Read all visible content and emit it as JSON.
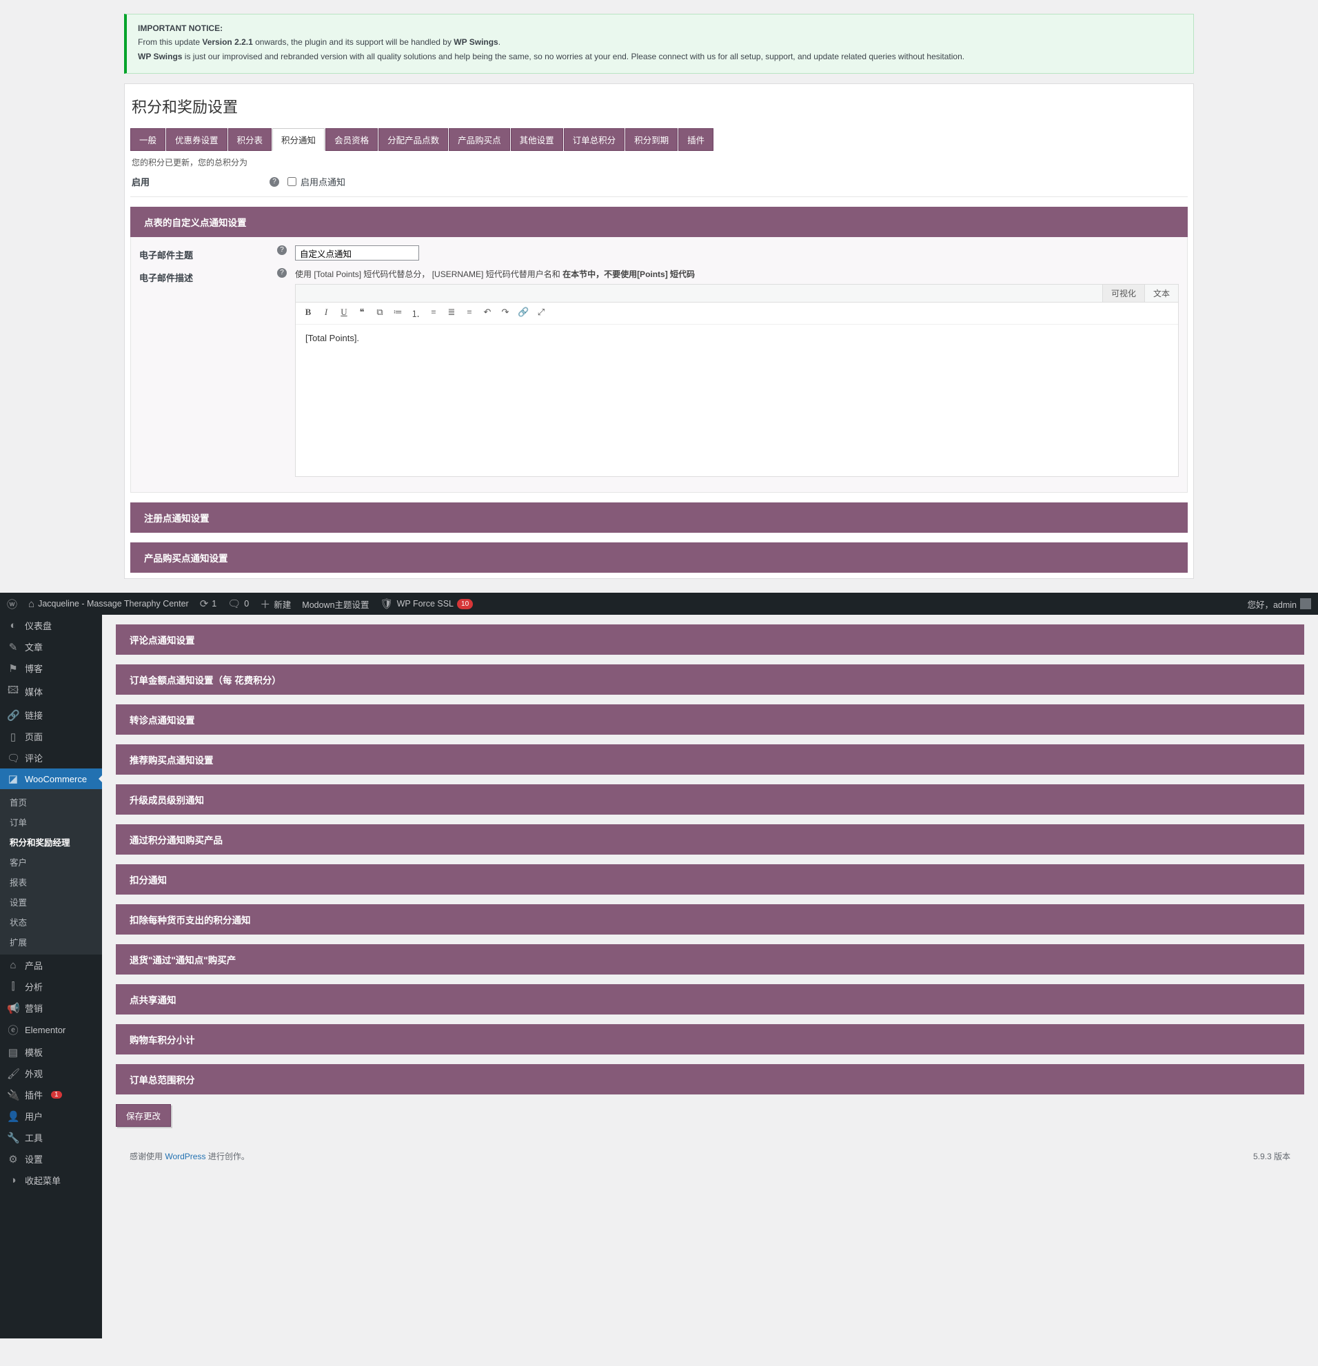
{
  "notice": {
    "heading": "IMPORTANT NOTICE:",
    "line1_a": "From this update ",
    "line1_b": "Version 2.2.1",
    "line1_c": " onwards, the plugin and its support will be handled by ",
    "line1_d": "WP Swings",
    "line1_e": ".",
    "line2_a": "WP Swings",
    "line2_b": " is just our improvised and rebranded version with all quality solutions and help being the same, so no worries at your end. Please connect with us for all setup, support, and update related queries without hesitation."
  },
  "page_title": "积分和奖励设置",
  "tabs": [
    "一般",
    "优惠券设置",
    "积分表",
    "积分通知",
    "会员资格",
    "分配产品点数",
    "产品购买点",
    "其他设置",
    "订单总积分",
    "积分到期",
    "插件"
  ],
  "active_tab_index": 3,
  "updated_msg": "您的积分已更新，您的总积分为",
  "enable": {
    "label": "启用",
    "checkbox_label": "启用点通知"
  },
  "section_open": {
    "title": "点表的自定义点通知设置",
    "subject_label": "电子邮件主题",
    "subject_value": "自定义点通知",
    "desc_label": "电子邮件描述",
    "desc_hint_a": "使用 [Total Points] 短代码代替总分，   [USERNAME] 短代码代替用户名和 ",
    "desc_hint_b": "在本节中，不要使用[Points] 短代码",
    "editor_tabs": {
      "visual": "可视化",
      "text": "文本"
    },
    "editor_body": "[Total Points]."
  },
  "collapsed_top": [
    "注册点通知设置",
    "产品购买点通知设置"
  ],
  "collapsed_bottom": [
    "评论点通知设置",
    "订单金额点通知设置（每 花费积分）",
    "转诊点通知设置",
    "推荐购买点通知设置",
    "升级成员级别通知",
    "通过积分通知购买产品",
    "扣分通知",
    "扣除每种货币支出的积分通知",
    "退货\"通过\"通知点\"购买产",
    "点共享通知",
    "购物车积分小计",
    "订单总范围积分"
  ],
  "save_label": "保存更改",
  "adminbar": {
    "site": "Jacqueline - Massage Theraphy Center",
    "updates": "1",
    "comments": "0",
    "new": "新建",
    "modown": "Modown主题设置",
    "wpforce": "WP Force SSL",
    "wpforce_badge": "10",
    "greeting": "您好，admin"
  },
  "sidebar": {
    "items": [
      {
        "ico": "◐",
        "label": "仪表盘"
      },
      {
        "ico": "✎",
        "label": "文章"
      },
      {
        "ico": "⚑",
        "label": "博客"
      },
      {
        "ico": "🖾",
        "label": "媒体"
      },
      {
        "ico": "🔗",
        "label": "链接"
      },
      {
        "ico": "▯",
        "label": "页面"
      },
      {
        "ico": "🗨",
        "label": "评论"
      }
    ],
    "woo_label": "WooCommerce",
    "woo_sub": [
      "首页",
      "订单",
      "积分和奖励经理",
      "客户",
      "报表",
      "设置",
      "状态",
      "扩展"
    ],
    "woo_sub_active_index": 2,
    "items2": [
      {
        "ico": "⌂",
        "label": "产品"
      },
      {
        "ico": "⫿",
        "label": "分析"
      },
      {
        "ico": "📢",
        "label": "营销"
      },
      {
        "ico": "ⓔ",
        "label": "Elementor"
      },
      {
        "ico": "▤",
        "label": "模板"
      },
      {
        "ico": "🖌",
        "label": "外观"
      },
      {
        "ico": "🔌",
        "label": "插件",
        "badge": "1"
      },
      {
        "ico": "👤",
        "label": "用户"
      },
      {
        "ico": "🔧",
        "label": "工具"
      },
      {
        "ico": "⚙",
        "label": "设置"
      },
      {
        "ico": "◑",
        "label": "收起菜单"
      }
    ]
  },
  "footer": {
    "thanks_a": "感谢使用 ",
    "thanks_link": "WordPress",
    "thanks_b": " 进行创作。",
    "version": "5.9.3 版本"
  }
}
